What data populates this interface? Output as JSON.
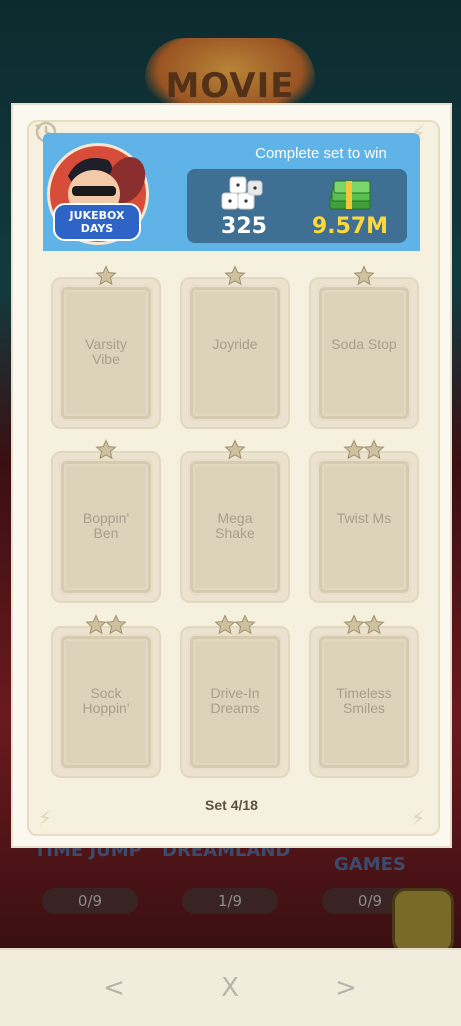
{
  "background": {
    "banner_text": "MOVIE",
    "labels": [
      "TIME JUMP",
      "DREAMLAND",
      "GAMES"
    ],
    "counters": [
      "0/9",
      "1/9",
      "0/9"
    ]
  },
  "header": {
    "title": "Complete set to win",
    "album_badge": "JUKEBOX\nDAYS",
    "rewards": {
      "dice": "325",
      "cash": "9.57M"
    }
  },
  "cards": [
    {
      "name": "Varsity\nVibe",
      "stars": 1
    },
    {
      "name": "Joyride",
      "stars": 1
    },
    {
      "name": "Soda Stop",
      "stars": 1
    },
    {
      "name": "Boppin'\nBen",
      "stars": 1
    },
    {
      "name": "Mega\nShake",
      "stars": 1
    },
    {
      "name": "Twist Ms",
      "stars": 2
    },
    {
      "name": "Sock\nHoppin'",
      "stars": 2
    },
    {
      "name": "Drive-In\nDreams",
      "stars": 2
    },
    {
      "name": "Timeless\nSmiles",
      "stars": 2
    }
  ],
  "set_label": "Set 4/18",
  "nav": {
    "prev": "<",
    "close": "X",
    "next": ">"
  },
  "colors": {
    "header_blue": "#5fb3e6",
    "reward_panel": "#3f6f93",
    "cash_yellow": "#ffd83a",
    "card_bg": "#ddd3bb",
    "star_gold": "#c9b88e"
  }
}
